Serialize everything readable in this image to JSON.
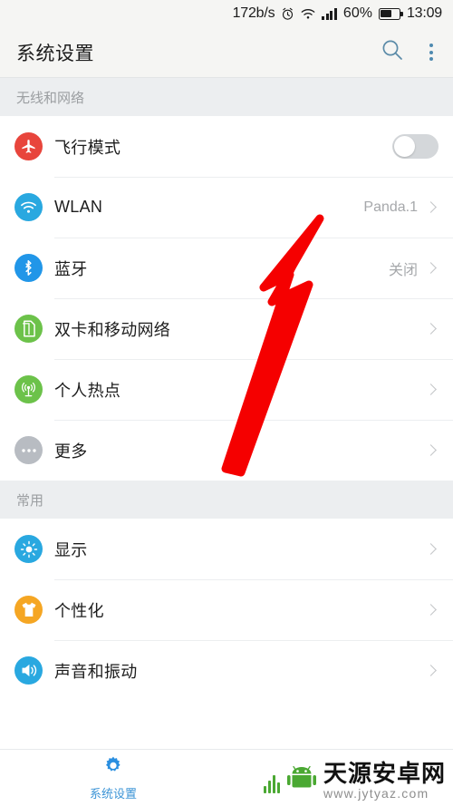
{
  "status_bar": {
    "net_speed": "172b/s",
    "alarm_icon": "alarm-clock-icon",
    "wifi_icon": "wifi-icon",
    "signal_icon": "cellular-signal-icon",
    "battery_percent": "60%",
    "battery_level": 60,
    "time": "13:09"
  },
  "app_bar": {
    "title": "系统设置",
    "search_icon": "search-icon",
    "overflow_icon": "overflow-menu-icon"
  },
  "sections": [
    {
      "header": "无线和网络",
      "rows": [
        {
          "icon": "airplane-icon",
          "icon_color": "#e8453c",
          "label": "飞行模式",
          "value": "",
          "control": "toggle",
          "toggle_on": false
        },
        {
          "icon": "wifi-icon",
          "icon_color": "#29a8e0",
          "label": "WLAN",
          "value": "Panda.1",
          "control": "chevron"
        },
        {
          "icon": "bluetooth-icon",
          "icon_color": "#2196e8",
          "label": "蓝牙",
          "value": "关闭",
          "control": "chevron"
        },
        {
          "icon": "sim-card-icon",
          "icon_color": "#6cc24a",
          "label": "双卡和移动网络",
          "value": "",
          "control": "chevron"
        },
        {
          "icon": "hotspot-icon",
          "icon_color": "#6cc24a",
          "label": "个人热点",
          "value": "",
          "control": "chevron"
        },
        {
          "icon": "more-dots-icon",
          "icon_color": "#b8bcc2",
          "label": "更多",
          "value": "",
          "control": "chevron"
        }
      ]
    },
    {
      "header": "常用",
      "rows": [
        {
          "icon": "brightness-icon",
          "icon_color": "#29a8e0",
          "label": "显示",
          "value": "",
          "control": "chevron"
        },
        {
          "icon": "tshirt-icon",
          "icon_color": "#f5a623",
          "label": "个性化",
          "value": "",
          "control": "chevron"
        },
        {
          "icon": "speaker-icon",
          "icon_color": "#29a8e0",
          "label": "声音和振动",
          "value": "",
          "control": "chevron"
        }
      ]
    }
  ],
  "bottom_bar": {
    "tab_label": "系统设置",
    "tab_icon": "gear-icon"
  },
  "watermark": {
    "site_name": "天源安卓网",
    "url": "www.jytyaz.com",
    "logo_icon": "android-robot-icon",
    "logo_color": "#4aa832"
  },
  "annotation": {
    "arrow_icon": "red-arrow-pointer",
    "arrow_color": "#f50000",
    "points_to": "WLAN"
  }
}
